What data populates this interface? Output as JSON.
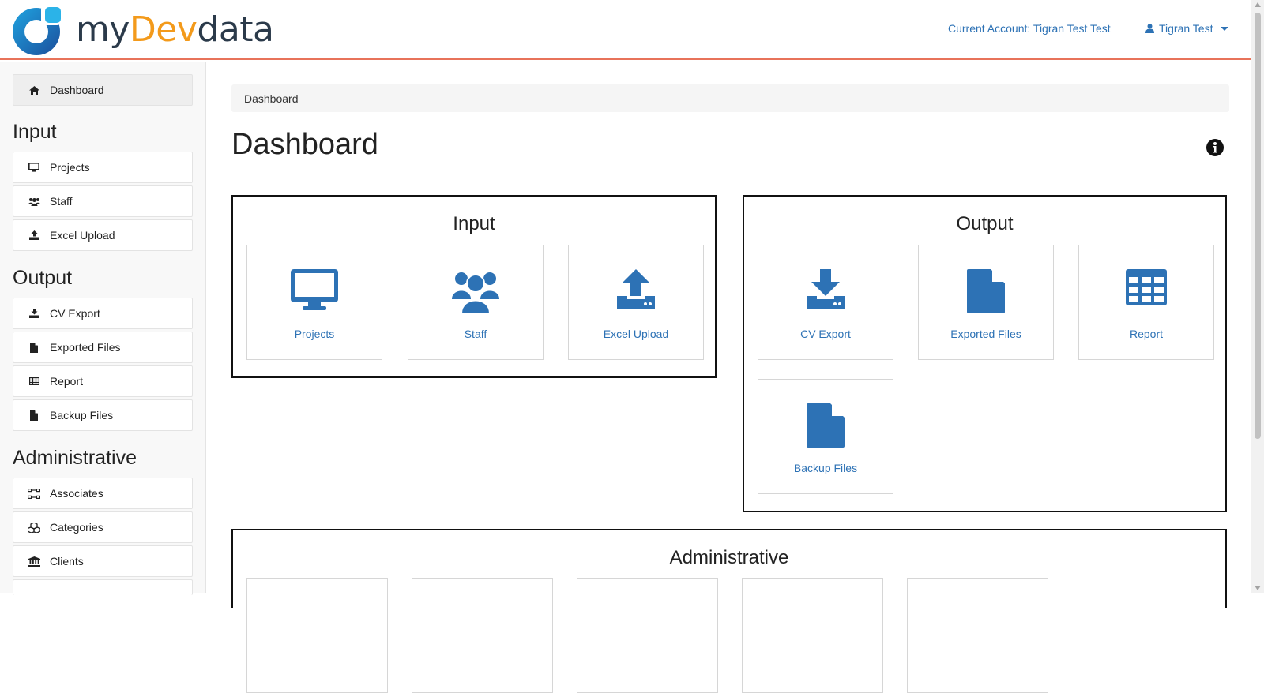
{
  "brand": {
    "part1": "my",
    "part2": "Dev",
    "part3": "data"
  },
  "header": {
    "current_account": "Current Account: Tigran Test Test",
    "user": "Tigran Test"
  },
  "sidebar": {
    "dashboard": "Dashboard",
    "input_heading": "Input",
    "input_items": [
      "Projects",
      "Staff",
      "Excel Upload"
    ],
    "output_heading": "Output",
    "output_items": [
      "CV Export",
      "Exported Files",
      "Report",
      "Backup Files"
    ],
    "admin_heading": "Administrative",
    "admin_items": [
      "Associates",
      "Categories",
      "Clients"
    ]
  },
  "breadcrumb": "Dashboard",
  "page_title": "Dashboard",
  "panels": {
    "input": {
      "title": "Input",
      "tiles": [
        "Projects",
        "Staff",
        "Excel Upload"
      ]
    },
    "output": {
      "title": "Output",
      "tiles": [
        "CV Export",
        "Exported Files",
        "Report",
        "Backup Files"
      ]
    },
    "administrative": {
      "title": "Administrative"
    }
  },
  "colors": {
    "accent": "#2d72b5",
    "header_rule": "#e8735a",
    "logo_orange": "#f39a1b"
  }
}
